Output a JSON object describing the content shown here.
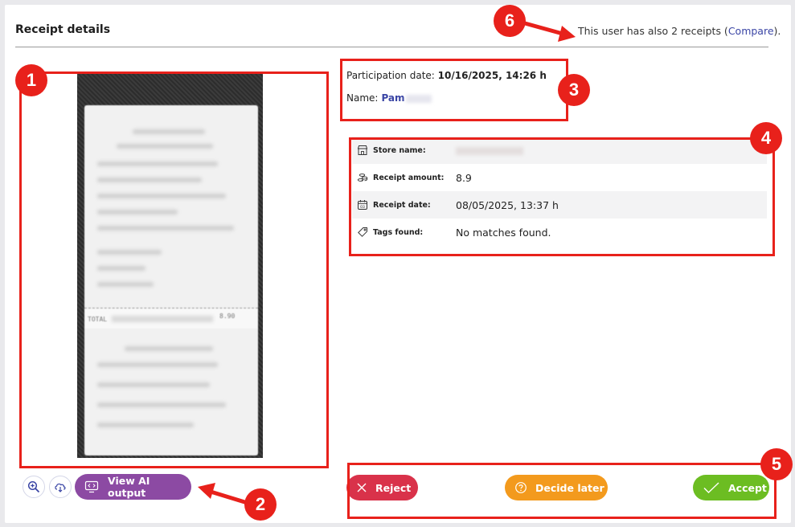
{
  "header": {
    "title": "Receipt details",
    "other_receipts_prefix": "This user has also 2 receipts (",
    "compare_link": "Compare",
    "other_receipts_suffix": ")."
  },
  "receipt_image": {
    "total_label": "TOTAL",
    "total_value": "8.90"
  },
  "tools": {
    "view_ai_output_label": "View AI output"
  },
  "participation": {
    "date_label": "Participation date:",
    "date_value": "10/16/2025, 14:26 h",
    "name_label": "Name:",
    "name_value": "Pam"
  },
  "details": {
    "rows": [
      {
        "label": "Store name:",
        "value": "",
        "icon": "store-icon"
      },
      {
        "label": "Receipt amount:",
        "value": "8.9",
        "icon": "coins-icon"
      },
      {
        "label": "Receipt date:",
        "value": "08/05/2025, 13:37 h",
        "icon": "calendar-icon"
      },
      {
        "label": "Tags found:",
        "value": "No matches found.",
        "icon": "tag-icon"
      }
    ]
  },
  "actions": {
    "reject_label": "Reject",
    "decide_later_label": "Decide later",
    "accept_label": "Accept"
  },
  "annotations": {
    "badges": [
      "1",
      "2",
      "3",
      "4",
      "5",
      "6"
    ]
  },
  "colors": {
    "annotation": "#e8211b",
    "reject": "#d9324a",
    "decide_later": "#f39a1d",
    "accept": "#6cbd22",
    "ai_button": "#8c4aa3",
    "link": "#3a45a5"
  }
}
